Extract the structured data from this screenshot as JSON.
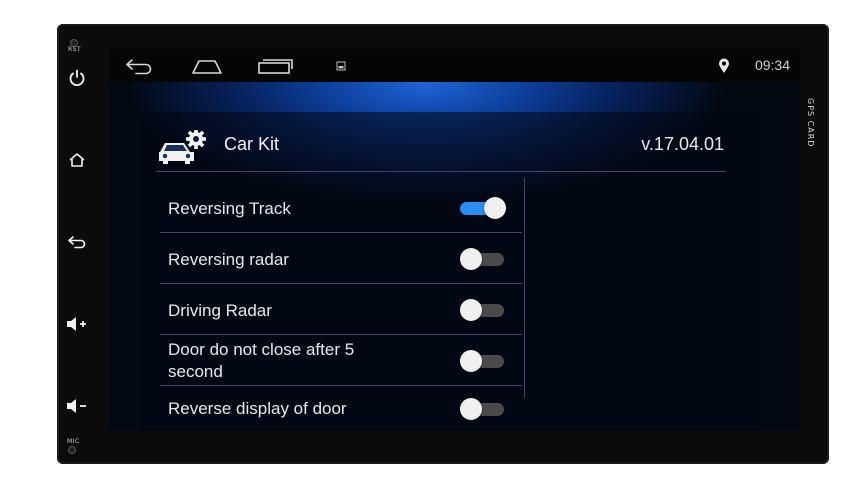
{
  "device": {
    "rst_label": "RST",
    "mic_label": "MIC",
    "gps_label": "GPS CARD"
  },
  "statusbar": {
    "time": "09:34",
    "icons": [
      "back-icon",
      "home-icon",
      "recent-apps-icon",
      "screenshot-icon",
      "location-pin-icon"
    ]
  },
  "app": {
    "title": "Car Kit",
    "version": "v.17.04.01",
    "icon": "car-gear-icon"
  },
  "settings": [
    {
      "label": "Reversing Track",
      "enabled": true
    },
    {
      "label": "Reversing radar",
      "enabled": false
    },
    {
      "label": "Driving Radar",
      "enabled": false
    },
    {
      "label": "Door do not close after 5 second",
      "enabled": false
    },
    {
      "label": "Reverse display of door",
      "enabled": false
    }
  ],
  "colors": {
    "accent": "#2d8cf0",
    "background_glow": "#1e66d8",
    "divider": "#3a4a66"
  }
}
